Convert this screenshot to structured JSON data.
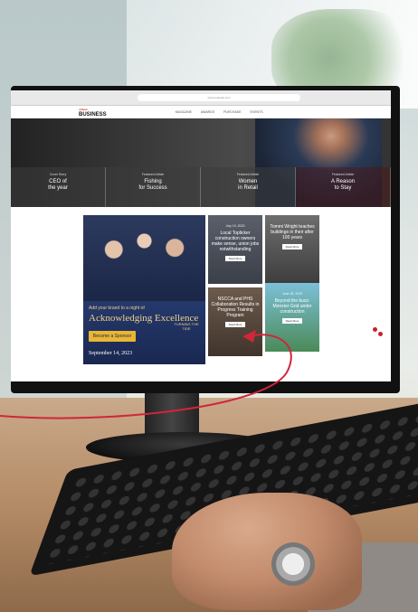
{
  "site": {
    "url": "www.example.com",
    "logo_top": "ottawa",
    "logo_main": "BUSINESS",
    "nav": [
      "MAGAZINE",
      "AWARDS",
      "PURCHASE",
      "EVENTS"
    ]
  },
  "hero_tiles": [
    {
      "kicker": "Cover Story",
      "title": "CEO of\nthe year"
    },
    {
      "kicker": "Featured Article",
      "title": "Fishing\nfor Success"
    },
    {
      "kicker": "Featured Article",
      "title": "Women\nin Retail"
    },
    {
      "kicker": "Featured Article",
      "title": "A Reason\nto Stay"
    }
  ],
  "ad": {
    "tagline": "Add your brand to a night of",
    "title": "Acknowledging Excellence",
    "button": "Become a Sponsor",
    "tide": "TURNING THE TIDE",
    "date": "September 14, 2023"
  },
  "cards": [
    {
      "date": "July 19, 2023",
      "headline": "Local Toplicker construction owners make sense, union jobs notwithstanding",
      "more": "Read More"
    },
    {
      "date": "",
      "headline": "Tommi Wright teaches buildings in their after 100 years",
      "more": "Read More"
    },
    {
      "date": "",
      "headline": "NSCCA and PHS Collaboration Results in Progress Training Program",
      "more": "Read More"
    },
    {
      "date": "June 28, 2023",
      "headline": "Beyond the buzz: Monster Grid under construction",
      "more": "Read More"
    }
  ],
  "colors": {
    "accent": "#c0262b",
    "ad_gold": "#e9b533"
  }
}
